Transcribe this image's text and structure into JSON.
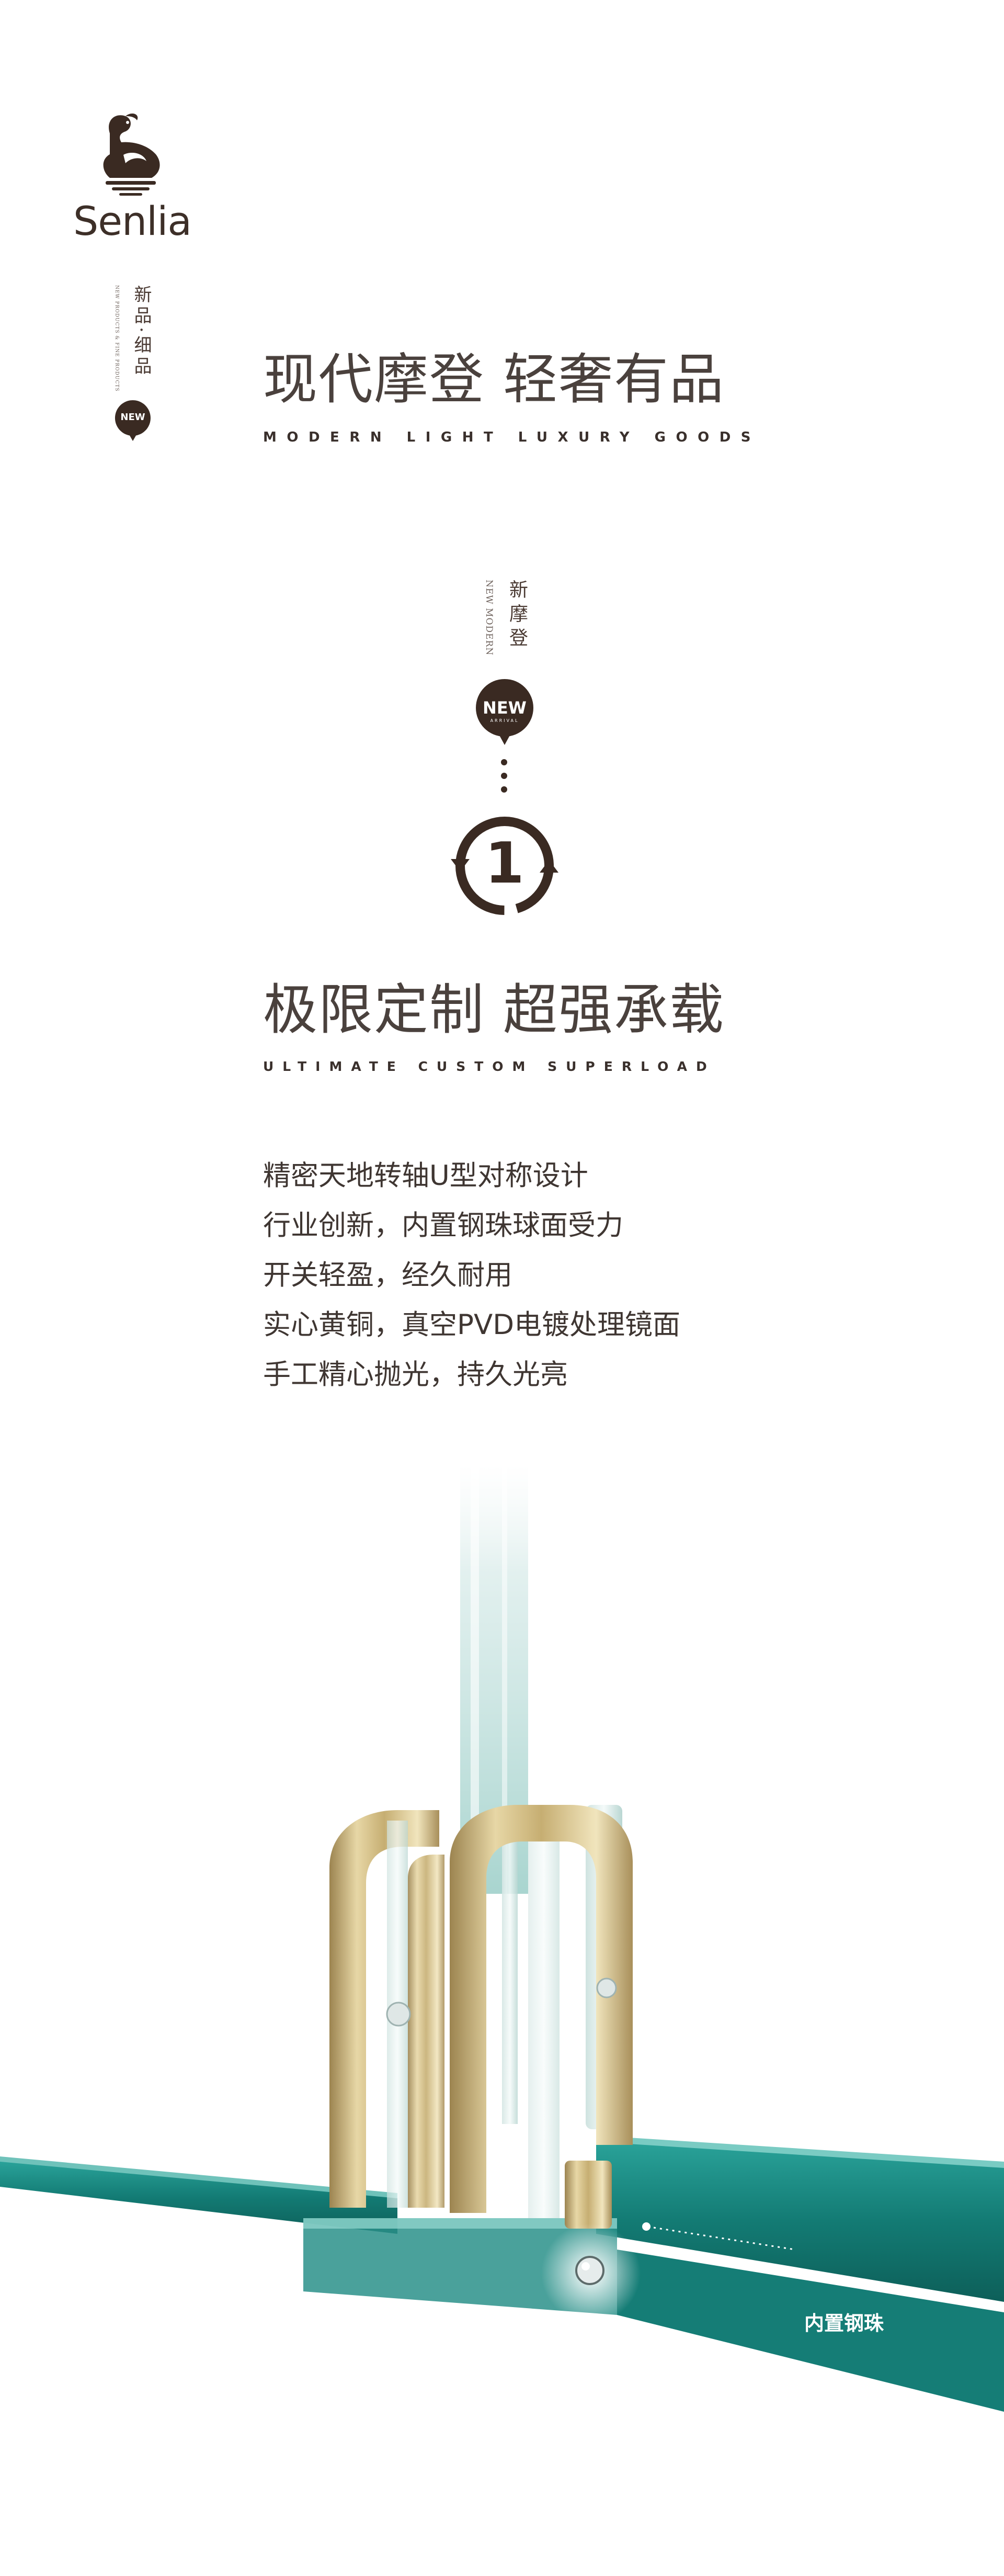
{
  "brand": {
    "name": "Senlia"
  },
  "side_label": {
    "cn": "新品·细品",
    "en": "NEW PRODUCTS & FINE PRODUCTS"
  },
  "new_badge_text": "NEW",
  "section_intro": {
    "title_cn": "现代摩登  轻奢有品",
    "title_en": "MODERN LIGHT LUXURY GOODS"
  },
  "feature_badge": {
    "cn": "新摩登",
    "en": "NEW MODERN",
    "badge_text": "NEW",
    "badge_sub": "ARRIVAL",
    "number": "1"
  },
  "feature": {
    "title_cn": "极限定制  超强承载",
    "title_en": "ULTIMATE CUSTOM SUPERLOAD",
    "lines": [
      "精密天地转轴U型对称设计",
      "行业创新，内置钢珠球面受力",
      "开关轻盈，经久耐用",
      "实心黄铜，真空PVD电镀处理镜面",
      "手工精心抛光，持久光亮"
    ]
  },
  "callout": {
    "label": "内置钢珠"
  },
  "colors": {
    "brand_brown": "#3a2a22",
    "glass_teal": "#1f8a82",
    "brass": "#c8b27a"
  }
}
